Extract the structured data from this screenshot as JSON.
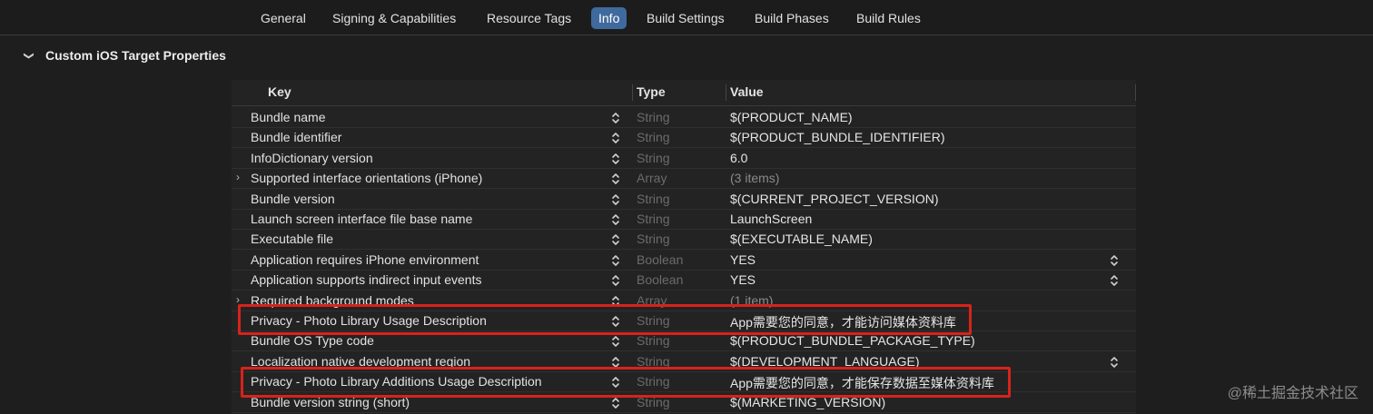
{
  "tabs": [
    {
      "label": "General",
      "selected": false
    },
    {
      "label": "Signing & Capabilities",
      "selected": false
    },
    {
      "label": "Resource Tags",
      "selected": false
    },
    {
      "label": "Info",
      "selected": true
    },
    {
      "label": "Build Settings",
      "selected": false
    },
    {
      "label": "Build Phases",
      "selected": false
    },
    {
      "label": "Build Rules",
      "selected": false
    }
  ],
  "section": {
    "title": "Custom iOS Target Properties",
    "expanded": true,
    "chevron_icon": "chevron-down-icon"
  },
  "table": {
    "columns": {
      "key": "Key",
      "type": "Type",
      "value": "Value"
    },
    "rows": [
      {
        "key": "Bundle name",
        "type": "String",
        "value": "$(PRODUCT_NAME)",
        "expandable": false,
        "value_stepper": false
      },
      {
        "key": "Bundle identifier",
        "type": "String",
        "value": "$(PRODUCT_BUNDLE_IDENTIFIER)",
        "expandable": false,
        "value_stepper": false
      },
      {
        "key": "InfoDictionary version",
        "type": "String",
        "value": "6.0",
        "expandable": false,
        "value_stepper": false
      },
      {
        "key": "Supported interface orientations (iPhone)",
        "type": "Array",
        "value": "(3 items)",
        "expandable": true,
        "value_stepper": false
      },
      {
        "key": "Bundle version",
        "type": "String",
        "value": "$(CURRENT_PROJECT_VERSION)",
        "expandable": false,
        "value_stepper": false
      },
      {
        "key": "Launch screen interface file base name",
        "type": "String",
        "value": "LaunchScreen",
        "expandable": false,
        "value_stepper": false
      },
      {
        "key": "Executable file",
        "type": "String",
        "value": "$(EXECUTABLE_NAME)",
        "expandable": false,
        "value_stepper": false
      },
      {
        "key": "Application requires iPhone environment",
        "type": "Boolean",
        "value": "YES",
        "expandable": false,
        "value_stepper": true
      },
      {
        "key": "Application supports indirect input events",
        "type": "Boolean",
        "value": "YES",
        "expandable": false,
        "value_stepper": true
      },
      {
        "key": "Required background modes",
        "type": "Array",
        "value": "(1 item)",
        "expandable": true,
        "value_stepper": false
      },
      {
        "key": "Privacy - Photo Library Usage Description",
        "type": "String",
        "value": "App需要您的同意，才能访问媒体资料库",
        "expandable": false,
        "value_stepper": false,
        "highlighted": true
      },
      {
        "key": "Bundle OS Type code",
        "type": "String",
        "value": "$(PRODUCT_BUNDLE_PACKAGE_TYPE)",
        "expandable": false,
        "value_stepper": false
      },
      {
        "key": "Localization native development region",
        "type": "String",
        "value": "$(DEVELOPMENT_LANGUAGE)",
        "expandable": false,
        "value_stepper": true
      },
      {
        "key": "Privacy - Photo Library Additions Usage Description",
        "type": "String",
        "value": "App需要您的同意，才能保存数据至媒体资料库",
        "expandable": false,
        "value_stepper": false,
        "highlighted": true
      },
      {
        "key": "Bundle version string (short)",
        "type": "String",
        "value": "$(MARKETING_VERSION)",
        "expandable": false,
        "value_stepper": false
      }
    ]
  },
  "colors": {
    "selected_tab": "#3f6a9d",
    "highlight_border": "#d7231b",
    "background": "#1e1e1e"
  },
  "icons": {
    "disclosure": "chevron-right-icon",
    "stepper": "up-down-stepper-icon"
  },
  "watermark": "@稀土掘金技术社区"
}
